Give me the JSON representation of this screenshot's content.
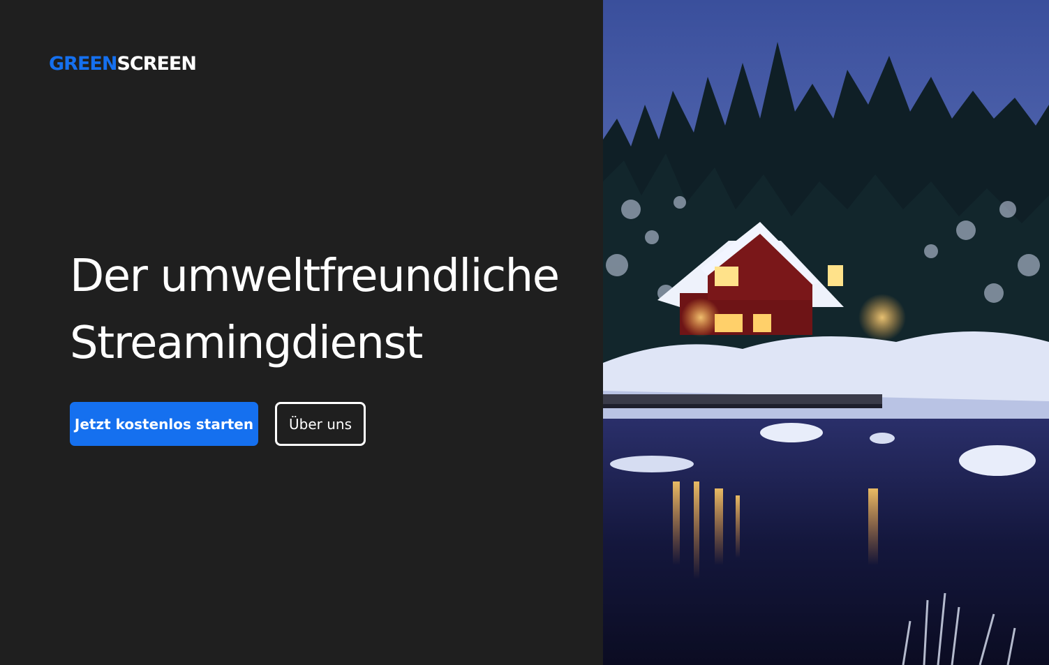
{
  "brand": {
    "logo_part_a": "GREEN",
    "logo_part_b": "SCREEN",
    "accent_color": "#1570ef",
    "background_color": "#1f1f1f"
  },
  "hero": {
    "headline_line_1": "Der umweltfreundliche",
    "headline_line_2": "Streamingdienst",
    "primary_cta_label": "Jetzt kostenlos starten",
    "secondary_cta_label": "Über uns"
  },
  "image": {
    "description_icon": "winter-lake-house-photo"
  }
}
